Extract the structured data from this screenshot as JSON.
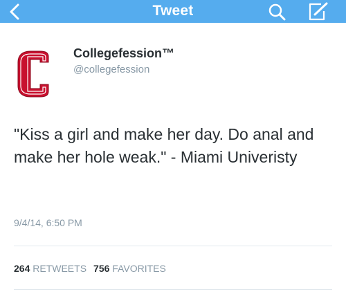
{
  "navbar": {
    "title": "Tweet",
    "back_icon": "chevron-left-icon",
    "search_icon": "search-icon",
    "compose_icon": "compose-icon",
    "bar_color": "#55acee"
  },
  "user": {
    "name": "Collegefession™",
    "handle": "@collegefession",
    "avatar_letter": "C",
    "avatar_color": "#c8102e"
  },
  "tweet": {
    "text": "\"Kiss a girl and make her day. Do anal and make her hole weak.\" - Miami Univeristy",
    "timestamp": "9/4/14, 6:50 PM"
  },
  "stats": {
    "retweets_count": "264",
    "retweets_label": "RETWEETS",
    "favorites_count": "756",
    "favorites_label": "FAVORITES"
  }
}
